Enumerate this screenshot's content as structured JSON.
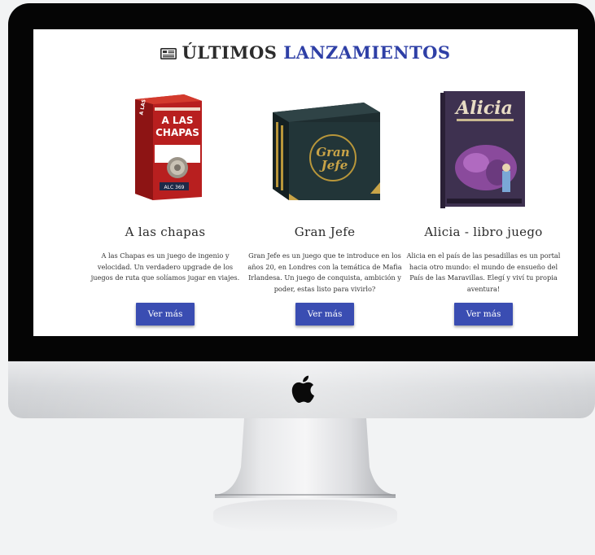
{
  "section": {
    "title_part1": "ÚLTIMOS",
    "title_part2": "LANZAMIENTOS",
    "title_icon": "newspaper-icon",
    "accent_color": "#2e3fa6"
  },
  "products": [
    {
      "name": "A las chapas",
      "image_icon": "game-box-a-las-chapas",
      "description": "A las Chapas es un juego de ingenio y velocidad. Un verdadero upgrade de los juegos de ruta que solíamos jugar en viajes.",
      "button_label": "Ver más"
    },
    {
      "name": "Gran Jefe",
      "image_icon": "game-box-gran-jefe",
      "description": "Gran Jefe es un juego que te introduce en los años 20, en Londres con la temática de Mafia Irlandesa. Un juego de conquista, ambición y poder, estas listo para vivirlo?",
      "button_label": "Ver más"
    },
    {
      "name": "Alicia - libro juego",
      "image_icon": "book-alicia",
      "description": "Alicia en el país de las pesadillas es un portal hacia otro mundo: el mundo de ensueño del País de las Maravillas. Elegí y viví tu propia aventura!",
      "button_label": "Ver más"
    }
  ],
  "device": {
    "logo_icon": "apple-logo-icon",
    "button_color": "#3a4db2"
  }
}
